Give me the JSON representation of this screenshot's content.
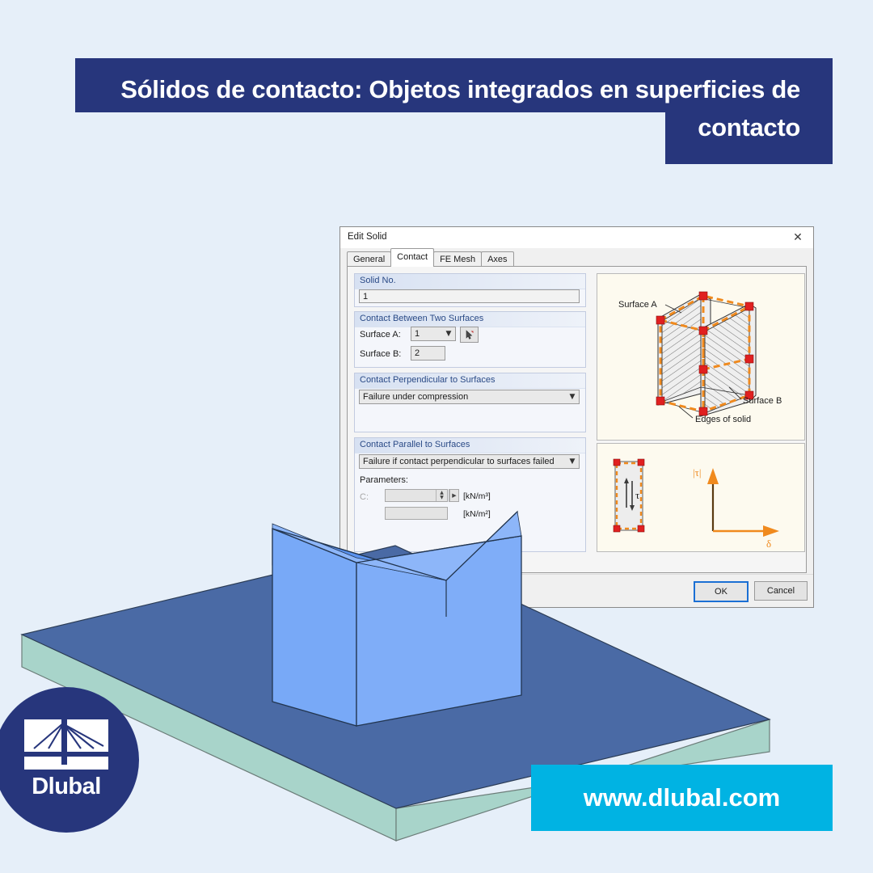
{
  "page": {
    "background_color": "#e6eff9",
    "brand_navy": "#27367c",
    "brand_cyan": "#00b3e3"
  },
  "title_banner": {
    "text": "Sólidos de contacto: Objetos integrados en superficies de contacto"
  },
  "dialog": {
    "title": "Edit Solid",
    "close_icon": "close-icon",
    "tabs": [
      {
        "label": "General",
        "active": false
      },
      {
        "label": "Contact",
        "active": true
      },
      {
        "label": "FE Mesh",
        "active": false
      },
      {
        "label": "Axes",
        "active": false
      }
    ],
    "solid_no": {
      "group_label": "Solid No.",
      "value": "1"
    },
    "contact_between": {
      "group_label": "Contact Between Two Surfaces",
      "surface_a_label": "Surface A:",
      "surface_a_value": "1",
      "surface_b_label": "Surface B:",
      "surface_b_value": "2",
      "pick_icon": "pick-cursor-icon"
    },
    "contact_perpendicular": {
      "group_label": "Contact Perpendicular to Surfaces",
      "selected": "Failure under compression"
    },
    "contact_parallel": {
      "group_label": "Contact Parallel to Surfaces",
      "selected": "Failure if contact perpendicular to surfaces failed",
      "parameters_label": "Parameters:",
      "param_c_label": "C:",
      "param_c_value": "",
      "param_c_unit": "[kN/m³]",
      "param_2_unit": "[kN/m²]"
    },
    "diagram_top": {
      "label_surface_a": "Surface A",
      "label_surface_b": "Surface B",
      "label_edges": "Edges of solid"
    },
    "diagram_bottom": {
      "label_tau": "τ",
      "axis_y": "|τ|",
      "axis_x": "δ"
    },
    "buttons": {
      "ok": "OK",
      "cancel": "Cancel"
    }
  },
  "logo": {
    "wordmark": "Dlubal",
    "mark_icon": "bridge-logo-icon"
  },
  "url_banner": {
    "text": "www.dlubal.com"
  }
}
